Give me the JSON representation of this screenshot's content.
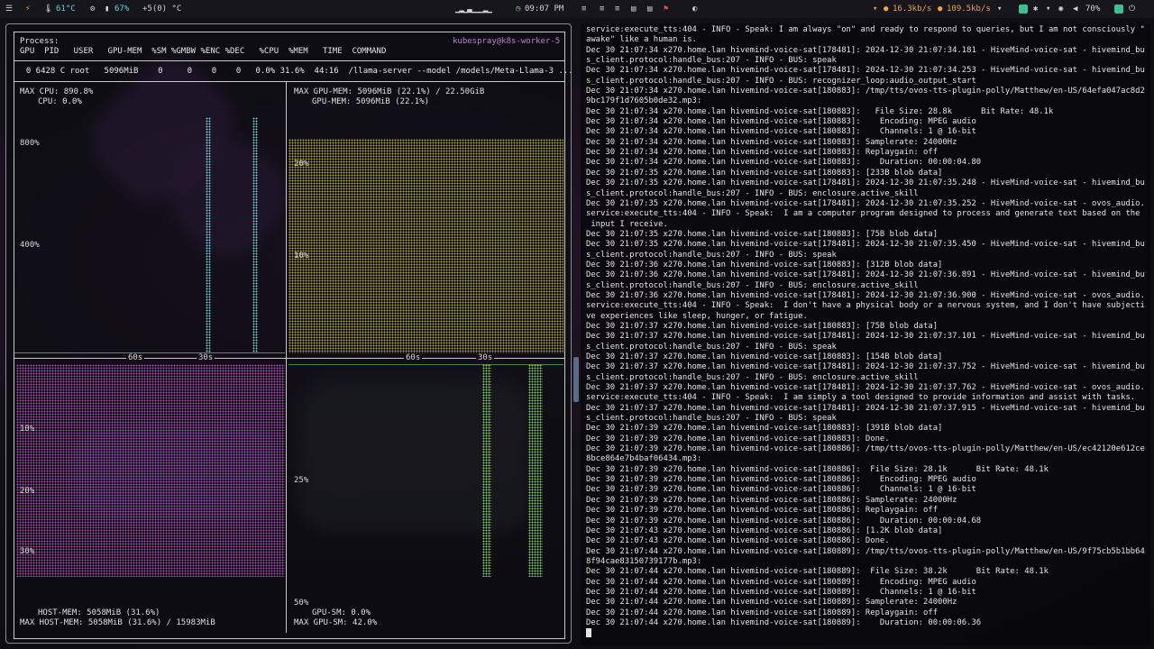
{
  "top_bar": {
    "temp": "61°C",
    "battery": "67%",
    "weather": "+5(0) °C",
    "clock": "09:07 PM",
    "net_down": "16.3kb/s",
    "net_up": "109.5kb/s",
    "battery_right": "70%"
  },
  "nvtop": {
    "process_label": "Process:",
    "host": "kubespray@k8s-worker-5",
    "columns": "GPU  PID   USER   GPU-MEM  %SM %GMBW %ENC %DEC   %CPU  %MEM   TIME  COMMAND",
    "process_row": "  0 6428 C root   5096MiB    0     0    0    0   0.0% 31.6%  44:16  /llama-server --model /models/Meta-Llama-3 ...",
    "cpu_max": "MAX CPU: 890.8%",
    "cpu": "CPU: 0.0%",
    "gpu_mem_max": "MAX GPU-MEM: 5096MiB (22.1%) / 22.50GiB",
    "gpu_mem": "GPU-MEM: 5096MiB (22.1%)",
    "host_mem": "HOST-MEM: 5058MiB (31.6%)",
    "host_mem_max": "MAX HOST-MEM: 5058MiB (31.6%) / 15983MiB",
    "gpu_sm": "GPU-SM: 0.0%",
    "gpu_sm_max": "MAX GPU-SM: 42.0%",
    "ticks": {
      "cpu_800": "800%",
      "cpu_400": "400%",
      "mem_20": "20%",
      "mem_10": "10%",
      "host_10": "10%",
      "host_20": "20%",
      "host_30": "30%",
      "sm_25": "25%",
      "sm_50": "50%",
      "t60": "60s",
      "t30": "30s"
    }
  },
  "log_lines": [
    "service:execute_tts:404 - INFO - Speak: I am always \"on\" and ready to respond to queries, but I am not consciously \"",
    "awake\" like a human is.",
    "Dec 30 21:07:34 x270.home.lan hivemind-voice-sat[178481]: 2024-12-30 21:07:34.181 - HiveMind-voice-sat - hivemind_bu",
    "s_client.protocol:handle_bus:207 - INFO - BUS: speak",
    "Dec 30 21:07:34 x270.home.lan hivemind-voice-sat[178481]: 2024-12-30 21:07:34.253 - HiveMind-voice-sat - hivemind_bu",
    "s_client.protocol:handle_bus:207 - INFO - BUS: recognizer_loop:audio_output_start",
    "Dec 30 21:07:34 x270.home.lan hivemind-voice-sat[180883]: /tmp/tts/ovos-tts-plugin-polly/Matthew/en-US/64efa047ac8d2",
    "9bc179f1d7605b0de32.mp3:",
    "Dec 30 21:07:34 x270.home.lan hivemind-voice-sat[180883]:   File Size: 28.8k      Bit Rate: 48.1k",
    "Dec 30 21:07:34 x270.home.lan hivemind-voice-sat[180883]:    Encoding: MPEG audio",
    "Dec 30 21:07:34 x270.home.lan hivemind-voice-sat[180883]:    Channels: 1 @ 16-bit",
    "Dec 30 21:07:34 x270.home.lan hivemind-voice-sat[180883]: Samplerate: 24000Hz",
    "Dec 30 21:07:34 x270.home.lan hivemind-voice-sat[180883]: Replaygain: off",
    "Dec 30 21:07:34 x270.home.lan hivemind-voice-sat[180883]:    Duration: 00:00:04.80",
    "Dec 30 21:07:35 x270.home.lan hivemind-voice-sat[180883]: [233B blob data]",
    "Dec 30 21:07:35 x270.home.lan hivemind-voice-sat[178481]: 2024-12-30 21:07:35.248 - HiveMind-voice-sat - hivemind_bu",
    "s_client.protocol:handle_bus:207 - INFO - BUS: enclosure.active_skill",
    "Dec 30 21:07:35 x270.home.lan hivemind-voice-sat[178481]: 2024-12-30 21:07:35.252 - HiveMind-voice-sat - ovos_audio.",
    "service:execute_tts:404 - INFO - Speak:  I am a computer program designed to process and generate text based on the",
    " input I receive.",
    "Dec 30 21:07:35 x270.home.lan hivemind-voice-sat[180883]: [75B blob data]",
    "Dec 30 21:07:35 x270.home.lan hivemind-voice-sat[178481]: 2024-12-30 21:07:35.450 - HiveMind-voice-sat - hivemind_bu",
    "s_client.protocol:handle_bus:207 - INFO - BUS: speak",
    "Dec 30 21:07:36 x270.home.lan hivemind-voice-sat[180883]: [312B blob data]",
    "Dec 30 21:07:36 x270.home.lan hivemind-voice-sat[178481]: 2024-12-30 21:07:36.891 - HiveMind-voice-sat - hivemind_bu",
    "s_client.protocol:handle_bus:207 - INFO - BUS: enclosure.active_skill",
    "Dec 30 21:07:36 x270.home.lan hivemind-voice-sat[178481]: 2024-12-30 21:07:36.900 - HiveMind-voice-sat - ovos_audio.",
    "service:execute_tts:404 - INFO - Speak:  I don't have a physical body or a nervous system, and I don't have subjecti",
    "ve experiences like sleep, hunger, or fatigue.",
    "Dec 30 21:07:37 x270.home.lan hivemind-voice-sat[180883]: [75B blob data]",
    "Dec 30 21:07:37 x270.home.lan hivemind-voice-sat[178481]: 2024-12-30 21:07:37.101 - HiveMind-voice-sat - hivemind_bu",
    "s_client.protocol:handle_bus:207 - INFO - BUS: speak",
    "Dec 30 21:07:37 x270.home.lan hivemind-voice-sat[180883]: [154B blob data]",
    "Dec 30 21:07:37 x270.home.lan hivemind-voice-sat[178481]: 2024-12-30 21:07:37.752 - HiveMind-voice-sat - hivemind_bu",
    "s_client.protocol:handle_bus:207 - INFO - BUS: enclosure.active_skill",
    "Dec 30 21:07:37 x270.home.lan hivemind-voice-sat[178481]: 2024-12-30 21:07:37.762 - HiveMind-voice-sat - ovos_audio.",
    "service:execute_tts:404 - INFO - Speak:  I am simply a tool designed to provide information and assist with tasks.",
    "Dec 30 21:07:37 x270.home.lan hivemind-voice-sat[178481]: 2024-12-30 21:07:37.915 - HiveMind-voice-sat - hivemind_bu",
    "s_client.protocol:handle_bus:207 - INFO - BUS: speak",
    "Dec 30 21:07:39 x270.home.lan hivemind-voice-sat[180883]: [391B blob data]",
    "Dec 30 21:07:39 x270.home.lan hivemind-voice-sat[180883]: Done.",
    "Dec 30 21:07:39 x270.home.lan hivemind-voice-sat[180886]: /tmp/tts/ovos-tts-plugin-polly/Matthew/en-US/ec42120e612ce",
    "8bce864e7b4baf06434.mp3:",
    "Dec 30 21:07:39 x270.home.lan hivemind-voice-sat[180886]:  File Size: 28.1k      Bit Rate: 48.1k",
    "Dec 30 21:07:39 x270.home.lan hivemind-voice-sat[180886]:    Encoding: MPEG audio",
    "Dec 30 21:07:39 x270.home.lan hivemind-voice-sat[180886]:    Channels: 1 @ 16-bit",
    "Dec 30 21:07:39 x270.home.lan hivemind-voice-sat[180886]: Samplerate: 24000Hz",
    "Dec 30 21:07:39 x270.home.lan hivemind-voice-sat[180886]: Replaygain: off",
    "Dec 30 21:07:39 x270.home.lan hivemind-voice-sat[180886]:    Duration: 00:00:04.68",
    "Dec 30 21:07:43 x270.home.lan hivemind-voice-sat[180886]: [1.2K blob data]",
    "Dec 30 21:07:43 x270.home.lan hivemind-voice-sat[180886]: Done.",
    "Dec 30 21:07:44 x270.home.lan hivemind-voice-sat[180889]: /tmp/tts/ovos-tts-plugin-polly/Matthew/en-US/9f75cb5b1bb64",
    "8f94cae83150739177b.mp3:",
    "Dec 30 21:07:44 x270.home.lan hivemind-voice-sat[180889]:  File Size: 38.2k      Bit Rate: 48.1k",
    "Dec 30 21:07:44 x270.home.lan hivemind-voice-sat[180889]:    Encoding: MPEG audio",
    "Dec 30 21:07:44 x270.home.lan hivemind-voice-sat[180889]:    Channels: 1 @ 16-bit",
    "Dec 30 21:07:44 x270.home.lan hivemind-voice-sat[180889]: Samplerate: 24000Hz",
    "Dec 30 21:07:44 x270.home.lan hivemind-voice-sat[180889]: Replaygain: off",
    "Dec 30 21:07:44 x270.home.lan hivemind-voice-sat[180889]:    Duration: 00:00:06.36"
  ],
  "colors": {
    "accent_cyan": "#5fd7d7",
    "host_magenta": "#c054c8",
    "gpu_mem_yellow": "#b7b43a",
    "gpu_sm_green": "#7ccd5a"
  }
}
